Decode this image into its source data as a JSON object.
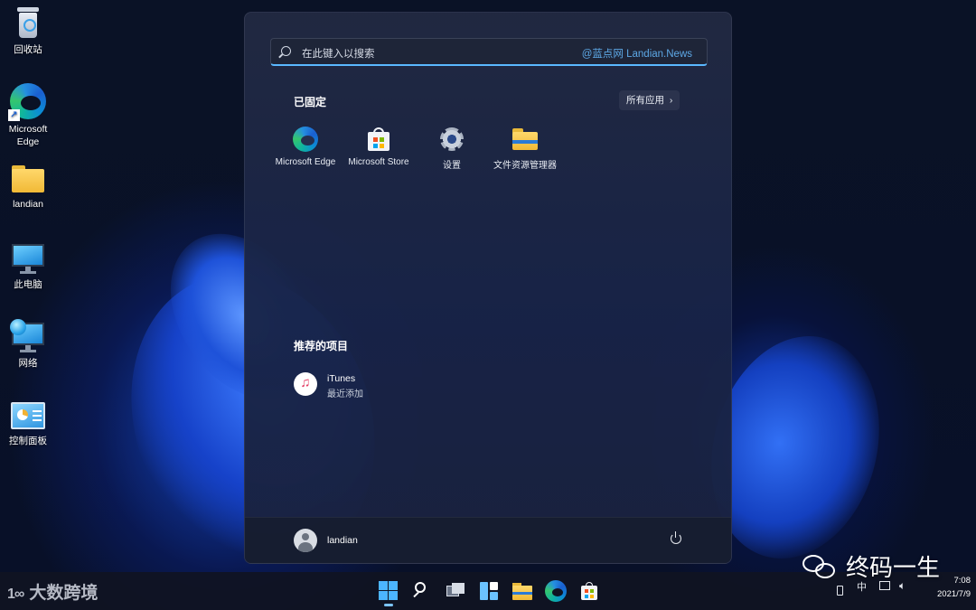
{
  "desktop": {
    "icons": [
      {
        "label": "回收站",
        "icon": "recycle-bin-icon"
      },
      {
        "label": "Microsoft Edge",
        "icon": "edge-icon"
      },
      {
        "label": "landian",
        "icon": "folder-icon"
      },
      {
        "label": "此电脑",
        "icon": "computer-icon"
      },
      {
        "label": "网络",
        "icon": "network-icon"
      },
      {
        "label": "控制面板",
        "icon": "control-panel-icon"
      }
    ]
  },
  "start_menu": {
    "search": {
      "placeholder": "在此键入以搜索",
      "watermark": "@蓝点网 Landian.News"
    },
    "pinned": {
      "title": "已固定",
      "all_apps": "所有应用",
      "items": [
        {
          "label": "Microsoft Edge",
          "icon": "edge-icon"
        },
        {
          "label": "Microsoft Store",
          "icon": "store-icon"
        },
        {
          "label": "设置",
          "icon": "settings-gear-icon"
        },
        {
          "label": "文件资源管理器",
          "icon": "file-explorer-icon"
        }
      ]
    },
    "recommended": {
      "title": "推荐的项目",
      "items": [
        {
          "name": "iTunes",
          "subtitle": "最近添加",
          "icon": "itunes-icon"
        }
      ]
    },
    "footer": {
      "user": "landian"
    }
  },
  "taskbar": {
    "brand": "大数跨境",
    "brand_logo": "1∞",
    "apps": [
      "start-icon",
      "search-icon",
      "task-view-icon",
      "widgets-icon",
      "file-explorer-icon",
      "edge-icon",
      "store-icon"
    ],
    "tray": {
      "language": "中",
      "time": "7:08",
      "date": "2021/7/9"
    }
  },
  "watermark": {
    "wechat_text": "终码一生"
  },
  "colors": {
    "accent": "#5ab8ff",
    "start_bg": "#222a42",
    "taskbar_bg": "#101422"
  }
}
